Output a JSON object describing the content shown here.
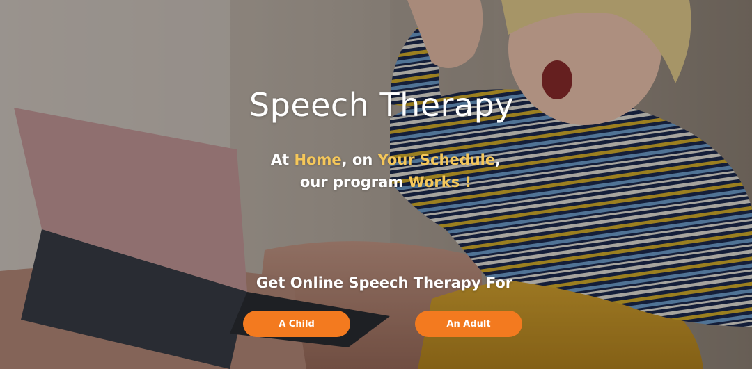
{
  "hero": {
    "title": "Speech Therapy",
    "tagline": {
      "line1_part1": "At ",
      "line1_hl1": "Home",
      "line1_part2": ", on ",
      "line1_hl2": "Your Schedule",
      "line1_part3": ",",
      "line2_part1": "our program ",
      "line2_hl1": "Works !"
    },
    "cta_heading": "Get Online Speech Therapy For",
    "buttons": {
      "child_label": "A Child",
      "adult_label": "An Adult"
    }
  },
  "colors": {
    "accent_orange": "#f37a1f",
    "highlight_yellow": "#f5c75a",
    "text_white": "#ffffff"
  },
  "background": {
    "image_semantic": "smiling-child-waving-at-laptop-photo"
  }
}
